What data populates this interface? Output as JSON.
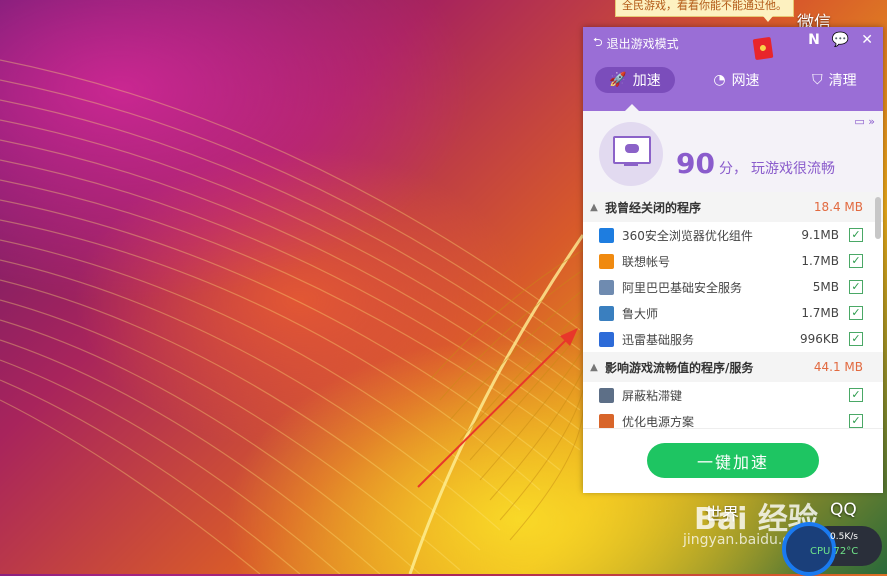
{
  "desktop": {
    "icons": [
      {
        "label": "微信"
      },
      {
        "label": "世界"
      },
      {
        "label": "QQ"
      }
    ],
    "tooltip_text": "全民游戏，看看你能不能通过他。"
  },
  "panel": {
    "exit_mode_label": "退出游戏模式",
    "header_icons": [
      "N",
      "chat-icon",
      "close-icon"
    ],
    "tabs": [
      {
        "label": "加速",
        "icon": "rocket-icon",
        "active": true
      },
      {
        "label": "网速",
        "icon": "gauge-icon",
        "active": false
      },
      {
        "label": "清理",
        "icon": "broom-icon",
        "active": false
      }
    ],
    "score": {
      "value": "90",
      "unit_text": "分，",
      "comment": "玩游戏很流畅"
    },
    "groups": [
      {
        "title": "我曾经关闭的程序",
        "size": "18.4 MB",
        "items": [
          {
            "name": "360安全浏览器优化组件",
            "size": "9.1MB",
            "checked": true,
            "icon_color": "#1e7de0"
          },
          {
            "name": "联想帐号",
            "size": "1.7MB",
            "checked": true,
            "icon_color": "#f08a10"
          },
          {
            "name": "阿里巴巴基础安全服务",
            "size": "5MB",
            "checked": true,
            "icon_color": "#6f8bb0"
          },
          {
            "name": "鲁大师",
            "size": "1.7MB",
            "checked": true,
            "icon_color": "#3a7fbf"
          },
          {
            "name": "迅雷基础服务",
            "size": "996KB",
            "checked": true,
            "icon_color": "#2d6bd8"
          }
        ]
      },
      {
        "title": "影响游戏流畅值的程序/服务",
        "size": "44.1 MB",
        "items": [
          {
            "name": "屏蔽粘滞键",
            "size": "",
            "checked": true,
            "icon_color": "#5d6f87"
          },
          {
            "name": "优化电源方案",
            "size": "",
            "checked": true,
            "icon_color": "#d8652a"
          }
        ]
      }
    ],
    "accelerate_button": "一键加速"
  },
  "widget": {
    "speed": "0.5K/s",
    "cpu": "CPU 72°C"
  },
  "watermark": {
    "logo": "Bai 经验",
    "url": "jingyan.baidu.com"
  },
  "colors": {
    "purple": "#9a6ed6",
    "green": "#1ec562",
    "orange_size": "#e26a40"
  }
}
